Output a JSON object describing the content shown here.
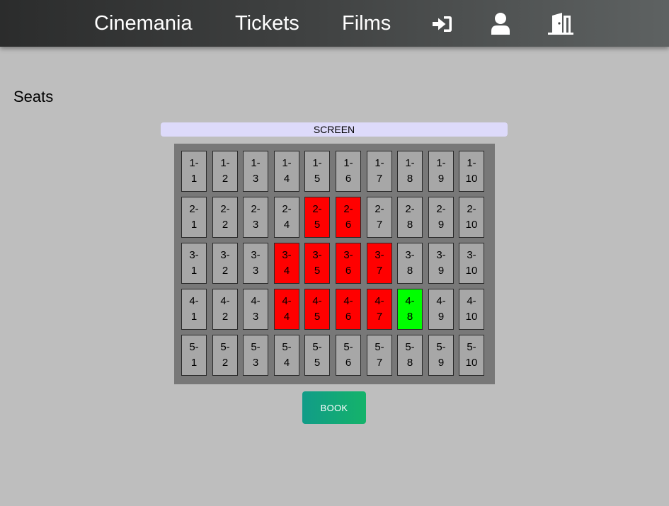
{
  "nav": {
    "brand": "Cinemania",
    "tickets": "Tickets",
    "films": "Films",
    "icons": [
      "login-icon",
      "user-icon",
      "logout-door-icon"
    ]
  },
  "page": {
    "title": "Seats"
  },
  "screen": {
    "label": "SCREEN"
  },
  "seats": {
    "rows": 5,
    "columns": 10,
    "booked": [
      "2-5",
      "2-6",
      "3-4",
      "3-5",
      "3-6",
      "3-7",
      "4-4",
      "4-5",
      "4-6",
      "4-7"
    ],
    "selected": [
      "4-8"
    ]
  },
  "book_button": {
    "label": "BOOK"
  },
  "colors": {
    "available": "#a7a7a7",
    "booked": "#ff0000",
    "selected": "#00ff00",
    "background": "#bebebe",
    "screen": "#dddafa",
    "book_button": "#12a87a"
  }
}
